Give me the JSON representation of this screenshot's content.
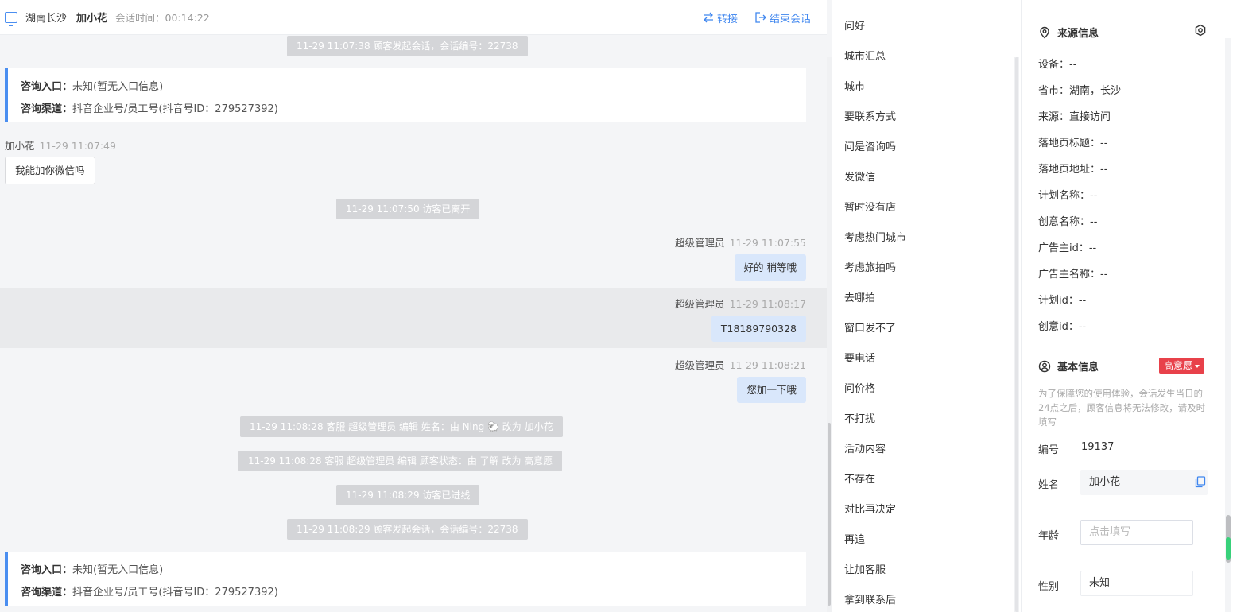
{
  "header": {
    "location": "湖南长沙",
    "visitor_name": "加小花",
    "session_time": "会话时间：00:14:22",
    "transfer_label": "转接",
    "end_label": "结束会话"
  },
  "chat": {
    "sys1": "11-29 11:07:38 顾客发起会话，会话编号：22738",
    "entry1": {
      "label1": "咨询入口：",
      "value1": "未知(暂无入口信息)",
      "label2": "咨询渠道：",
      "value2": "抖音企业号/员工号(抖音号ID：279527392)"
    },
    "msg1": {
      "sender": "加小花",
      "time": "11-29 11:07:49",
      "text": "我能加你微信吗"
    },
    "sys2": "11-29 11:07:50 访客已离开",
    "msg2": {
      "sender": "超级管理员",
      "time": "11-29 11:07:55",
      "text": "好的 稍等哦"
    },
    "msg3": {
      "sender": "超级管理员",
      "time": "11-29 11:08:17",
      "text": "T18189790328"
    },
    "msg4": {
      "sender": "超级管理员",
      "time": "11-29 11:08:21",
      "text": "您加一下哦"
    },
    "sys3": "11-29 11:08:28 客服 超级管理员 编辑 姓名：由 Ning 🐑 改为 加小花",
    "sys4": "11-29 11:08:28 客服 超级管理员 编辑 顾客状态：由 了解 改为 高意愿",
    "sys5": "11-29 11:08:29 访客已进线",
    "sys6": "11-29 11:08:29 顾客发起会话，会话编号：22738",
    "entry2": {
      "label1": "咨询入口：",
      "value1": "未知(暂无入口信息)",
      "label2": "咨询渠道：",
      "value2": "抖音企业号/员工号(抖音号ID：279527392)"
    }
  },
  "quick_replies": [
    "问好",
    "城市汇总",
    "城市",
    "要联系方式",
    "问是咨询吗",
    "发微信",
    "暂时没有店",
    "考虑热门城市",
    "考虑旅拍吗",
    "去哪拍",
    "窗口发不了",
    "要电话",
    "问价格",
    "不打扰",
    "活动内容",
    "不存在",
    "对比再决定",
    "再追",
    "让加客服",
    "拿到联系后"
  ],
  "source_info": {
    "title": "来源信息",
    "fields": [
      "设备：--",
      "省市：湖南，长沙",
      "来源：直接访问",
      "落地页标题：--",
      "落地页地址：--",
      "计划名称：--",
      "创意名称：--",
      "广告主id：--",
      "广告主名称：--",
      "计划id：--",
      "创意id：--"
    ]
  },
  "basic_info": {
    "title": "基本信息",
    "intent_badge": "高意愿",
    "note": "为了保障您的使用体验，会话发生当日的24点之后，顾客信息将无法修改，请及时填写",
    "id_label": "编号",
    "id_value": "19137",
    "name_label": "姓名",
    "name_value": "加小花",
    "age_label": "年龄",
    "age_placeholder": "点击填写",
    "gender_label": "性别",
    "gender_value": "未知"
  },
  "colors": {
    "accent": "#3f86ef",
    "badge": "#e8414a",
    "bubble_agent": "#d9e7fb",
    "system": "#d4d5d8"
  },
  "icons": [
    "monitor-icon",
    "transfer-icon",
    "exit-icon",
    "location-pin-icon",
    "settings-icon",
    "user-circle-icon",
    "copy-icon"
  ]
}
